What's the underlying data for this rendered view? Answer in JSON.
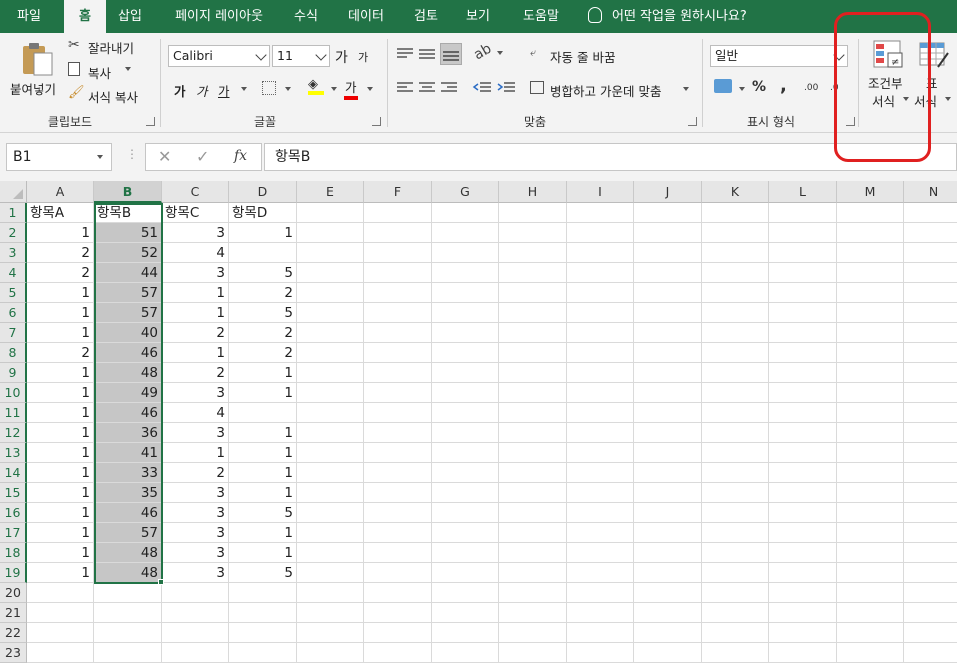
{
  "tabs": [
    {
      "label": "파일",
      "active": false
    },
    {
      "label": "홈",
      "active": true
    },
    {
      "label": "삽입",
      "active": false
    },
    {
      "label": "페이지 레이아웃",
      "active": false
    },
    {
      "label": "수식",
      "active": false
    },
    {
      "label": "데이터",
      "active": false
    },
    {
      "label": "검토",
      "active": false
    },
    {
      "label": "보기",
      "active": false
    },
    {
      "label": "도움말",
      "active": false
    }
  ],
  "tellme": "어떤 작업을 원하시나요?",
  "clipboard": {
    "paste": "붙여넣기",
    "cut": "잘라내기",
    "copy": "복사",
    "format_painter": "서식 복사",
    "group": "클립보드"
  },
  "font": {
    "name": "Calibri",
    "size": "11",
    "grow": "가",
    "shrink": "가",
    "bold": "가",
    "italic": "가",
    "underline": "가",
    "font_color": "가",
    "group": "글꼴"
  },
  "alignment": {
    "wrap_text": "자동 줄 바꿈",
    "merge_center": "병합하고 가운데 맞춤",
    "group": "맞춤"
  },
  "number": {
    "format": "일반",
    "percent": "%",
    "comma": ",",
    "inc_decimal": ".00",
    "dec_decimal": ".0",
    "group": "표시 형식"
  },
  "styles": {
    "conditional_line1": "조건부",
    "conditional_line2": "서식",
    "table_line1": "표",
    "table_line2": "서식"
  },
  "namebox": "B1",
  "fx": "fx",
  "formula": "항목B",
  "columns": [
    "A",
    "B",
    "C",
    "D",
    "E",
    "F",
    "G",
    "H",
    "I",
    "J",
    "K",
    "L",
    "M",
    "N"
  ],
  "selected_column": "B",
  "header_row": [
    "항목A",
    "항목B",
    "항목C",
    "항목D"
  ],
  "rows": [
    [
      1,
      51,
      3,
      1
    ],
    [
      2,
      52,
      4,
      null
    ],
    [
      2,
      44,
      3,
      5
    ],
    [
      1,
      57,
      1,
      2
    ],
    [
      1,
      57,
      1,
      5
    ],
    [
      1,
      40,
      2,
      2
    ],
    [
      2,
      46,
      1,
      2
    ],
    [
      1,
      48,
      2,
      1
    ],
    [
      1,
      49,
      3,
      1
    ],
    [
      1,
      46,
      4,
      null
    ],
    [
      1,
      36,
      3,
      1
    ],
    [
      1,
      41,
      1,
      1
    ],
    [
      1,
      33,
      2,
      1
    ],
    [
      1,
      35,
      3,
      1
    ],
    [
      1,
      46,
      3,
      5
    ],
    [
      1,
      57,
      3,
      1
    ],
    [
      1,
      48,
      3,
      1
    ],
    [
      1,
      48,
      3,
      5
    ]
  ],
  "row_numbers": [
    "1",
    "2",
    "3",
    "4",
    "5",
    "6",
    "7",
    "8",
    "9",
    "10",
    "11",
    "12",
    "13",
    "14",
    "15",
    "16",
    "17",
    "18",
    "19",
    "20",
    "21",
    "22",
    "23"
  ],
  "colors": {
    "accent": "#217346",
    "highlight_box": "#e02020",
    "selection_fill": "#c6c6c6"
  }
}
